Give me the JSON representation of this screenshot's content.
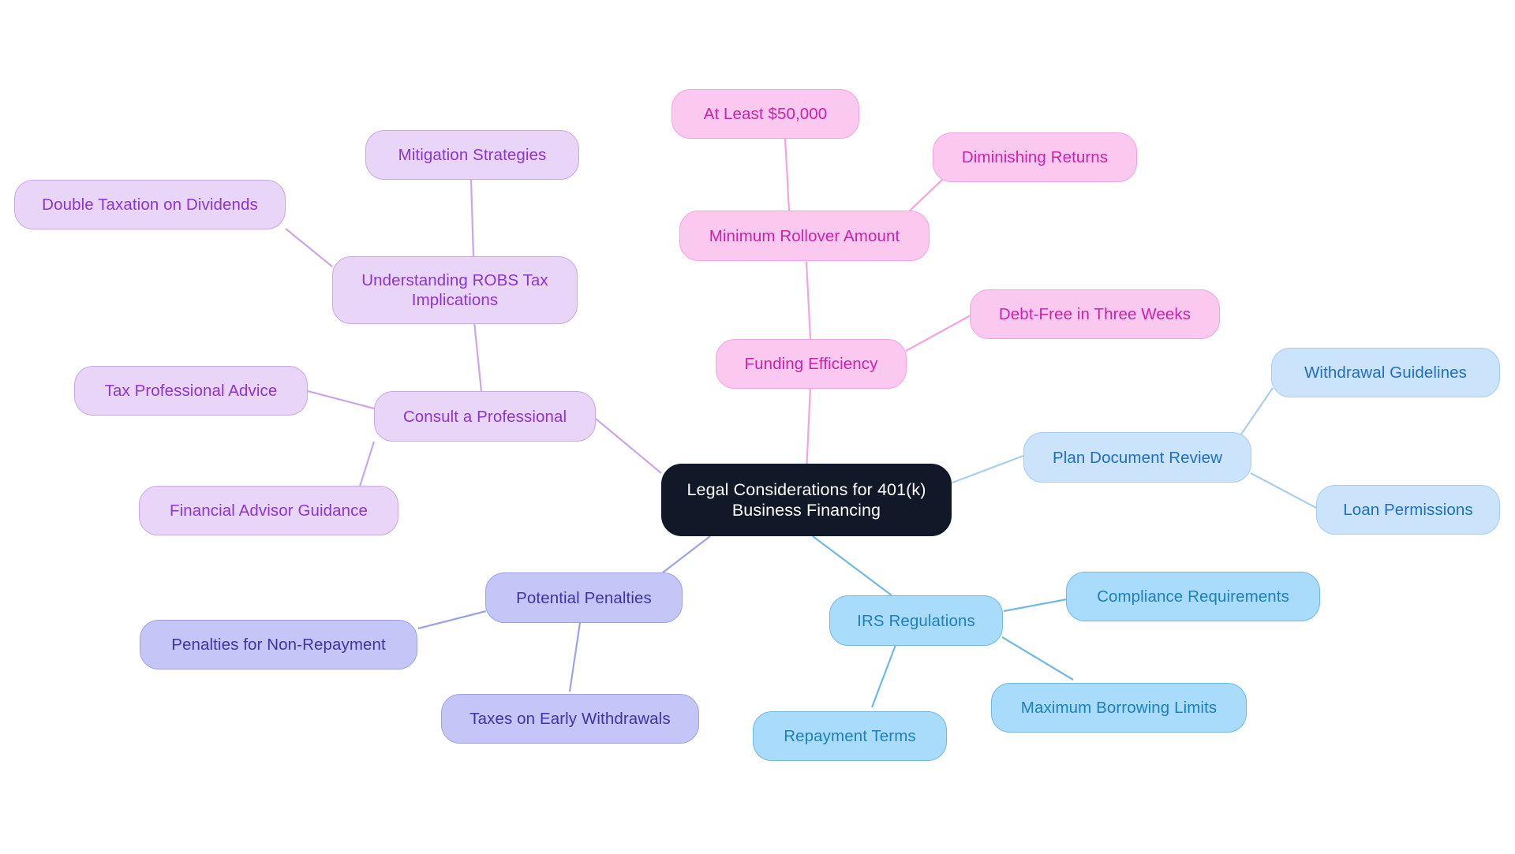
{
  "diagram": {
    "type": "mindmap",
    "title": "Legal Considerations for 401(k) Business Financing",
    "background_color": "#ffffff",
    "palette": {
      "root_fill": "#111827",
      "root_text": "#ffffff",
      "lavender_fill": "#e8d5f7",
      "lavender_border": "#c9a7e8",
      "lavender_text": "#8b35d4",
      "pink_fill": "#fbc9ef",
      "pink_border": "#f5a3e0",
      "pink_text": "#cc22a8",
      "lightblue_fill": "#cbe3fb",
      "lightblue_border": "#a6cdf2",
      "lightblue_text": "#1f6fc4",
      "cyan_fill": "#a8dcfa",
      "cyan_border": "#6fb9e4",
      "cyan_text": "#1f7fbd",
      "indigo_fill": "#c3c6f7",
      "indigo_border": "#9da2e8",
      "indigo_text": "#3b35a8"
    },
    "nodes": {
      "root": "Legal Considerations for 401(k)\nBusiness Financing",
      "understanding_robs_tax_implications": "Understanding ROBS Tax\nImplications",
      "double_taxation_on_dividends": "Double Taxation on Dividends",
      "mitigation_strategies": "Mitigation Strategies",
      "consult_a_professional": "Consult a Professional",
      "tax_professional_advice": "Tax Professional Advice",
      "financial_advisor_guidance": "Financial Advisor Guidance",
      "minimum_rollover_amount": "Minimum Rollover Amount",
      "at_least_50000": "At Least $50,000",
      "diminishing_returns": "Diminishing Returns",
      "funding_efficiency": "Funding Efficiency",
      "debt_free_in_three_weeks": "Debt-Free in Three Weeks",
      "plan_document_review": "Plan Document Review",
      "withdrawal_guidelines": "Withdrawal Guidelines",
      "loan_permissions": "Loan Permissions",
      "irs_regulations": "IRS Regulations",
      "compliance_requirements": "Compliance Requirements",
      "maximum_borrowing_limits": "Maximum Borrowing Limits",
      "repayment_terms": "Repayment Terms",
      "potential_penalties": "Potential Penalties",
      "penalties_for_non_repayment": "Penalties for Non-Repayment",
      "taxes_on_early_withdrawals": "Taxes on Early Withdrawals"
    }
  }
}
